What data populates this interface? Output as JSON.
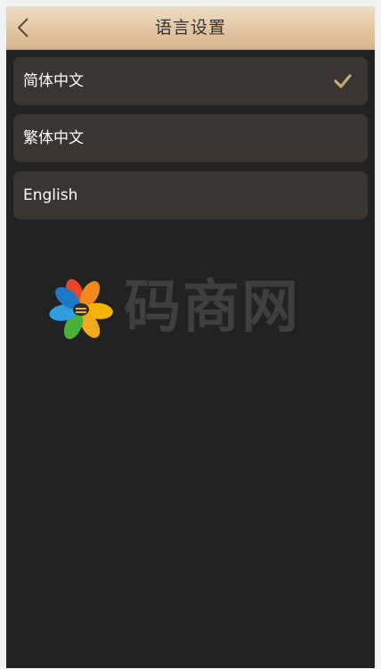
{
  "header": {
    "title": "语言设置",
    "back_icon": "chevron-left-icon"
  },
  "languages": [
    {
      "label": "简体中文",
      "selected": true
    },
    {
      "label": "繁体中文",
      "selected": false
    },
    {
      "label": "English",
      "selected": false
    }
  ],
  "selected_icon": "checkmark-icon",
  "watermark": {
    "text": "码商网",
    "logo": "flower-logo"
  },
  "colors": {
    "header_gradient_top": "#f0dcc3",
    "header_gradient_bottom": "#d6b589",
    "background": "#222222",
    "item_background": "#3a3530",
    "check_color": "#c8a878"
  }
}
